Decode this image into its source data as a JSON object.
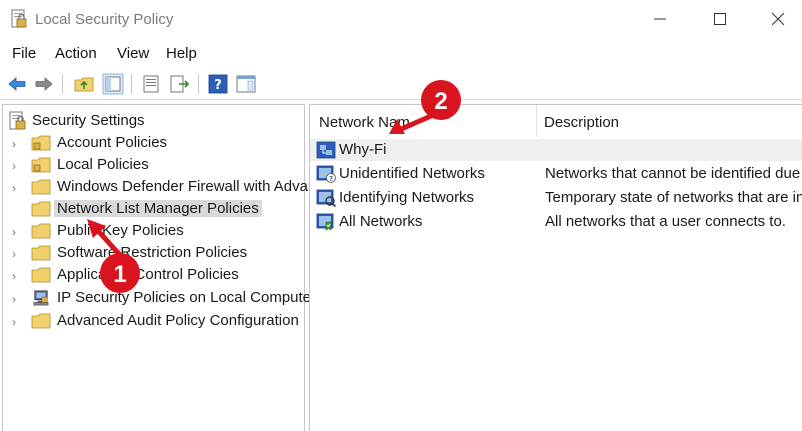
{
  "window": {
    "title": "Local Security Policy"
  },
  "menu": [
    "File",
    "Action",
    "View",
    "Help"
  ],
  "tree": {
    "root": "Security Settings",
    "items": [
      {
        "label": "Account Policies",
        "selected": false
      },
      {
        "label": "Local Policies",
        "selected": false
      },
      {
        "label": "Windows Defender Firewall with Advar",
        "selected": false
      },
      {
        "label": "Network List Manager Policies",
        "selected": true
      },
      {
        "label": "Public Key Policies",
        "selected": false
      },
      {
        "label": "Software Restriction Policies",
        "selected": false
      },
      {
        "label": "Application Control Policies",
        "selected": false
      },
      {
        "label": "IP Security Policies on Local Computer",
        "selected": false
      },
      {
        "label": "Advanced Audit Policy Configuration",
        "selected": false
      }
    ]
  },
  "list": {
    "columns": {
      "name": "Network Nam",
      "description": "Description"
    },
    "rows": [
      {
        "name": "Why-Fi",
        "description": ""
      },
      {
        "name": "Unidentified Networks",
        "description": "Networks that cannot be identified due"
      },
      {
        "name": "Identifying Networks",
        "description": "Temporary state of networks that are in"
      },
      {
        "name": "All Networks",
        "description": "All networks that a user connects to."
      }
    ]
  },
  "annotations": {
    "step1": "1",
    "step2": "2"
  },
  "colors": {
    "accent_red": "#d9141e",
    "folder_yellow": "#f2d06b",
    "selected_bg": "#d9d9d9",
    "row_highlight": "#efefef"
  }
}
